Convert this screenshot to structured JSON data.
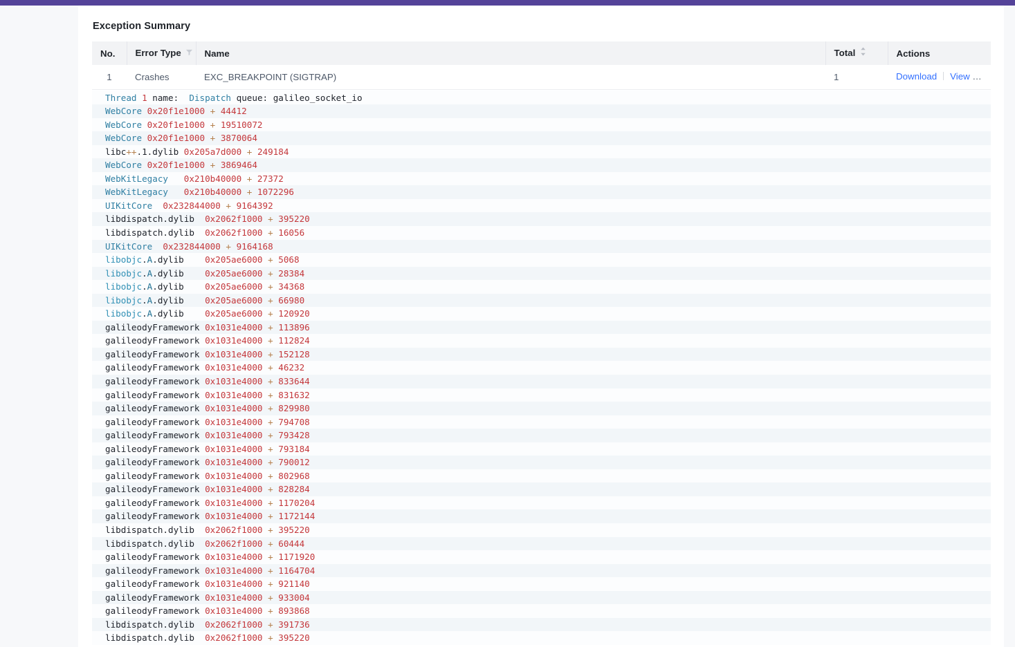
{
  "app_bar": {
    "color": "#544399"
  },
  "panel": {
    "title": "Exception Summary"
  },
  "table": {
    "columns": [
      {
        "key": "no",
        "label": "No.",
        "icon": null
      },
      {
        "key": "type",
        "label": "Error Type",
        "icon": "filter-icon"
      },
      {
        "key": "name",
        "label": "Name",
        "icon": null
      },
      {
        "key": "total",
        "label": "Total",
        "icon": "sort-icon"
      },
      {
        "key": "act",
        "label": "Actions",
        "icon": null
      }
    ],
    "rows": [
      {
        "no": "1",
        "type": "Crashes",
        "name": "EXC_BREAKPOINT (SIGTRAP)",
        "total": "1",
        "actions": {
          "download": "Download",
          "view_details": "View Details",
          "collapse_icon": "chevron-up-icon"
        }
      }
    ]
  },
  "log": {
    "lines": [
      {
        "tokens": [
          {
            "t": "Thread",
            "c": "blue"
          },
          {
            "t": " ",
            "c": "black"
          },
          {
            "t": "1",
            "c": "red"
          },
          {
            "t": " name:  ",
            "c": "black"
          },
          {
            "t": "Dispatch",
            "c": "blue"
          },
          {
            "t": " queue: galileo_socket_io",
            "c": "black"
          }
        ]
      },
      {
        "tokens": [
          {
            "t": "WebCore",
            "c": "blue"
          },
          {
            "t": " ",
            "c": "black"
          },
          {
            "t": "0x20f1e1000",
            "c": "red"
          },
          {
            "t": " + ",
            "c": "plus"
          },
          {
            "t": "44412",
            "c": "red"
          }
        ]
      },
      {
        "tokens": [
          {
            "t": "WebCore",
            "c": "blue"
          },
          {
            "t": " ",
            "c": "black"
          },
          {
            "t": "0x20f1e1000",
            "c": "red"
          },
          {
            "t": " + ",
            "c": "plus"
          },
          {
            "t": "19510072",
            "c": "red"
          }
        ]
      },
      {
        "tokens": [
          {
            "t": "WebCore",
            "c": "blue"
          },
          {
            "t": " ",
            "c": "black"
          },
          {
            "t": "0x20f1e1000",
            "c": "red"
          },
          {
            "t": " + ",
            "c": "plus"
          },
          {
            "t": "3870064",
            "c": "red"
          }
        ]
      },
      {
        "tokens": [
          {
            "t": "libc",
            "c": "black"
          },
          {
            "t": "++",
            "c": "plus"
          },
          {
            "t": ".1.dylib",
            "c": "black"
          },
          {
            "t": " ",
            "c": "black"
          },
          {
            "t": "0x205a7d000",
            "c": "red"
          },
          {
            "t": " + ",
            "c": "plus"
          },
          {
            "t": "249184",
            "c": "red"
          }
        ]
      },
      {
        "tokens": [
          {
            "t": "WebCore",
            "c": "blue"
          },
          {
            "t": " ",
            "c": "black"
          },
          {
            "t": "0x20f1e1000",
            "c": "red"
          },
          {
            "t": " + ",
            "c": "plus"
          },
          {
            "t": "3869464",
            "c": "red"
          }
        ]
      },
      {
        "tokens": [
          {
            "t": "WebKitLegacy",
            "c": "blue"
          },
          {
            "t": "   ",
            "c": "black"
          },
          {
            "t": "0x210b40000",
            "c": "red"
          },
          {
            "t": " + ",
            "c": "plus"
          },
          {
            "t": "27372",
            "c": "red"
          }
        ]
      },
      {
        "tokens": [
          {
            "t": "WebKitLegacy",
            "c": "blue"
          },
          {
            "t": "   ",
            "c": "black"
          },
          {
            "t": "0x210b40000",
            "c": "red"
          },
          {
            "t": " + ",
            "c": "plus"
          },
          {
            "t": "1072296",
            "c": "red"
          }
        ]
      },
      {
        "tokens": [
          {
            "t": "UIKitCore",
            "c": "blue"
          },
          {
            "t": "  ",
            "c": "black"
          },
          {
            "t": "0x232844000",
            "c": "red"
          },
          {
            "t": " + ",
            "c": "plus"
          },
          {
            "t": "9164392",
            "c": "red"
          }
        ]
      },
      {
        "tokens": [
          {
            "t": "libdispatch.dylib",
            "c": "black"
          },
          {
            "t": "  ",
            "c": "black"
          },
          {
            "t": "0x2062f1000",
            "c": "red"
          },
          {
            "t": " + ",
            "c": "plus"
          },
          {
            "t": "395220",
            "c": "red"
          }
        ]
      },
      {
        "tokens": [
          {
            "t": "libdispatch.dylib",
            "c": "black"
          },
          {
            "t": "  ",
            "c": "black"
          },
          {
            "t": "0x2062f1000",
            "c": "red"
          },
          {
            "t": " + ",
            "c": "plus"
          },
          {
            "t": "16056",
            "c": "red"
          }
        ]
      },
      {
        "tokens": [
          {
            "t": "UIKitCore",
            "c": "blue"
          },
          {
            "t": "  ",
            "c": "black"
          },
          {
            "t": "0x232844000",
            "c": "red"
          },
          {
            "t": " + ",
            "c": "plus"
          },
          {
            "t": "9164168",
            "c": "red"
          }
        ]
      },
      {
        "tokens": [
          {
            "t": "libobjc",
            "c": "blue2"
          },
          {
            "t": ".",
            "c": "black"
          },
          {
            "t": "A",
            "c": "teal"
          },
          {
            "t": ".dylib",
            "c": "black"
          },
          {
            "t": "    ",
            "c": "black"
          },
          {
            "t": "0x205ae6000",
            "c": "red"
          },
          {
            "t": " + ",
            "c": "plus"
          },
          {
            "t": "5068",
            "c": "red"
          }
        ]
      },
      {
        "tokens": [
          {
            "t": "libobjc",
            "c": "blue2"
          },
          {
            "t": ".",
            "c": "black"
          },
          {
            "t": "A",
            "c": "teal"
          },
          {
            "t": ".dylib",
            "c": "black"
          },
          {
            "t": "    ",
            "c": "black"
          },
          {
            "t": "0x205ae6000",
            "c": "red"
          },
          {
            "t": " + ",
            "c": "plus"
          },
          {
            "t": "28384",
            "c": "red"
          }
        ]
      },
      {
        "tokens": [
          {
            "t": "libobjc",
            "c": "blue2"
          },
          {
            "t": ".",
            "c": "black"
          },
          {
            "t": "A",
            "c": "teal"
          },
          {
            "t": ".dylib",
            "c": "black"
          },
          {
            "t": "    ",
            "c": "black"
          },
          {
            "t": "0x205ae6000",
            "c": "red"
          },
          {
            "t": " + ",
            "c": "plus"
          },
          {
            "t": "34368",
            "c": "red"
          }
        ]
      },
      {
        "tokens": [
          {
            "t": "libobjc",
            "c": "blue2"
          },
          {
            "t": ".",
            "c": "black"
          },
          {
            "t": "A",
            "c": "teal"
          },
          {
            "t": ".dylib",
            "c": "black"
          },
          {
            "t": "    ",
            "c": "black"
          },
          {
            "t": "0x205ae6000",
            "c": "red"
          },
          {
            "t": " + ",
            "c": "plus"
          },
          {
            "t": "66980",
            "c": "red"
          }
        ]
      },
      {
        "tokens": [
          {
            "t": "libobjc",
            "c": "blue2"
          },
          {
            "t": ".",
            "c": "black"
          },
          {
            "t": "A",
            "c": "teal"
          },
          {
            "t": ".dylib",
            "c": "black"
          },
          {
            "t": "    ",
            "c": "black"
          },
          {
            "t": "0x205ae6000",
            "c": "red"
          },
          {
            "t": " + ",
            "c": "plus"
          },
          {
            "t": "120920",
            "c": "red"
          }
        ]
      },
      {
        "tokens": [
          {
            "t": "galileodyFramework",
            "c": "black"
          },
          {
            "t": " ",
            "c": "black"
          },
          {
            "t": "0x1031e4000",
            "c": "red"
          },
          {
            "t": " + ",
            "c": "plus"
          },
          {
            "t": "113896",
            "c": "red"
          }
        ]
      },
      {
        "tokens": [
          {
            "t": "galileodyFramework",
            "c": "black"
          },
          {
            "t": " ",
            "c": "black"
          },
          {
            "t": "0x1031e4000",
            "c": "red"
          },
          {
            "t": " + ",
            "c": "plus"
          },
          {
            "t": "112824",
            "c": "red"
          }
        ]
      },
      {
        "tokens": [
          {
            "t": "galileodyFramework",
            "c": "black"
          },
          {
            "t": " ",
            "c": "black"
          },
          {
            "t": "0x1031e4000",
            "c": "red"
          },
          {
            "t": " + ",
            "c": "plus"
          },
          {
            "t": "152128",
            "c": "red"
          }
        ]
      },
      {
        "tokens": [
          {
            "t": "galileodyFramework",
            "c": "black"
          },
          {
            "t": " ",
            "c": "black"
          },
          {
            "t": "0x1031e4000",
            "c": "red"
          },
          {
            "t": " + ",
            "c": "plus"
          },
          {
            "t": "46232",
            "c": "red"
          }
        ]
      },
      {
        "tokens": [
          {
            "t": "galileodyFramework",
            "c": "black"
          },
          {
            "t": " ",
            "c": "black"
          },
          {
            "t": "0x1031e4000",
            "c": "red"
          },
          {
            "t": " + ",
            "c": "plus"
          },
          {
            "t": "833644",
            "c": "red"
          }
        ]
      },
      {
        "tokens": [
          {
            "t": "galileodyFramework",
            "c": "black"
          },
          {
            "t": " ",
            "c": "black"
          },
          {
            "t": "0x1031e4000",
            "c": "red"
          },
          {
            "t": " + ",
            "c": "plus"
          },
          {
            "t": "831632",
            "c": "red"
          }
        ]
      },
      {
        "tokens": [
          {
            "t": "galileodyFramework",
            "c": "black"
          },
          {
            "t": " ",
            "c": "black"
          },
          {
            "t": "0x1031e4000",
            "c": "red"
          },
          {
            "t": " + ",
            "c": "plus"
          },
          {
            "t": "829980",
            "c": "red"
          }
        ]
      },
      {
        "tokens": [
          {
            "t": "galileodyFramework",
            "c": "black"
          },
          {
            "t": " ",
            "c": "black"
          },
          {
            "t": "0x1031e4000",
            "c": "red"
          },
          {
            "t": " + ",
            "c": "plus"
          },
          {
            "t": "794708",
            "c": "red"
          }
        ]
      },
      {
        "tokens": [
          {
            "t": "galileodyFramework",
            "c": "black"
          },
          {
            "t": " ",
            "c": "black"
          },
          {
            "t": "0x1031e4000",
            "c": "red"
          },
          {
            "t": " + ",
            "c": "plus"
          },
          {
            "t": "793428",
            "c": "red"
          }
        ]
      },
      {
        "tokens": [
          {
            "t": "galileodyFramework",
            "c": "black"
          },
          {
            "t": " ",
            "c": "black"
          },
          {
            "t": "0x1031e4000",
            "c": "red"
          },
          {
            "t": " + ",
            "c": "plus"
          },
          {
            "t": "793184",
            "c": "red"
          }
        ]
      },
      {
        "tokens": [
          {
            "t": "galileodyFramework",
            "c": "black"
          },
          {
            "t": " ",
            "c": "black"
          },
          {
            "t": "0x1031e4000",
            "c": "red"
          },
          {
            "t": " + ",
            "c": "plus"
          },
          {
            "t": "790012",
            "c": "red"
          }
        ]
      },
      {
        "tokens": [
          {
            "t": "galileodyFramework",
            "c": "black"
          },
          {
            "t": " ",
            "c": "black"
          },
          {
            "t": "0x1031e4000",
            "c": "red"
          },
          {
            "t": " + ",
            "c": "plus"
          },
          {
            "t": "802968",
            "c": "red"
          }
        ]
      },
      {
        "tokens": [
          {
            "t": "galileodyFramework",
            "c": "black"
          },
          {
            "t": " ",
            "c": "black"
          },
          {
            "t": "0x1031e4000",
            "c": "red"
          },
          {
            "t": " + ",
            "c": "plus"
          },
          {
            "t": "828284",
            "c": "red"
          }
        ]
      },
      {
        "tokens": [
          {
            "t": "galileodyFramework",
            "c": "black"
          },
          {
            "t": " ",
            "c": "black"
          },
          {
            "t": "0x1031e4000",
            "c": "red"
          },
          {
            "t": " + ",
            "c": "plus"
          },
          {
            "t": "1170204",
            "c": "red"
          }
        ]
      },
      {
        "tokens": [
          {
            "t": "galileodyFramework",
            "c": "black"
          },
          {
            "t": " ",
            "c": "black"
          },
          {
            "t": "0x1031e4000",
            "c": "red"
          },
          {
            "t": " + ",
            "c": "plus"
          },
          {
            "t": "1172144",
            "c": "red"
          }
        ]
      },
      {
        "tokens": [
          {
            "t": "libdispatch.dylib",
            "c": "black"
          },
          {
            "t": "  ",
            "c": "black"
          },
          {
            "t": "0x2062f1000",
            "c": "red"
          },
          {
            "t": " + ",
            "c": "plus"
          },
          {
            "t": "395220",
            "c": "red"
          }
        ]
      },
      {
        "tokens": [
          {
            "t": "libdispatch.dylib",
            "c": "black"
          },
          {
            "t": "  ",
            "c": "black"
          },
          {
            "t": "0x2062f1000",
            "c": "red"
          },
          {
            "t": " + ",
            "c": "plus"
          },
          {
            "t": "60444",
            "c": "red"
          }
        ]
      },
      {
        "tokens": [
          {
            "t": "galileodyFramework",
            "c": "black"
          },
          {
            "t": " ",
            "c": "black"
          },
          {
            "t": "0x1031e4000",
            "c": "red"
          },
          {
            "t": " + ",
            "c": "plus"
          },
          {
            "t": "1171920",
            "c": "red"
          }
        ]
      },
      {
        "tokens": [
          {
            "t": "galileodyFramework",
            "c": "black"
          },
          {
            "t": " ",
            "c": "black"
          },
          {
            "t": "0x1031e4000",
            "c": "red"
          },
          {
            "t": " + ",
            "c": "plus"
          },
          {
            "t": "1164704",
            "c": "red"
          }
        ]
      },
      {
        "tokens": [
          {
            "t": "galileodyFramework",
            "c": "black"
          },
          {
            "t": " ",
            "c": "black"
          },
          {
            "t": "0x1031e4000",
            "c": "red"
          },
          {
            "t": " + ",
            "c": "plus"
          },
          {
            "t": "921140",
            "c": "red"
          }
        ]
      },
      {
        "tokens": [
          {
            "t": "galileodyFramework",
            "c": "black"
          },
          {
            "t": " ",
            "c": "black"
          },
          {
            "t": "0x1031e4000",
            "c": "red"
          },
          {
            "t": " + ",
            "c": "plus"
          },
          {
            "t": "933004",
            "c": "red"
          }
        ]
      },
      {
        "tokens": [
          {
            "t": "galileodyFramework",
            "c": "black"
          },
          {
            "t": " ",
            "c": "black"
          },
          {
            "t": "0x1031e4000",
            "c": "red"
          },
          {
            "t": " + ",
            "c": "plus"
          },
          {
            "t": "893868",
            "c": "red"
          }
        ]
      },
      {
        "tokens": [
          {
            "t": "libdispatch.dylib",
            "c": "black"
          },
          {
            "t": "  ",
            "c": "black"
          },
          {
            "t": "0x2062f1000",
            "c": "red"
          },
          {
            "t": " + ",
            "c": "plus"
          },
          {
            "t": "391736",
            "c": "red"
          }
        ]
      },
      {
        "tokens": [
          {
            "t": "libdispatch.dylib",
            "c": "black"
          },
          {
            "t": "  ",
            "c": "black"
          },
          {
            "t": "0x2062f1000",
            "c": "red"
          },
          {
            "t": " + ",
            "c": "plus"
          },
          {
            "t": "395220",
            "c": "red"
          }
        ]
      }
    ]
  }
}
